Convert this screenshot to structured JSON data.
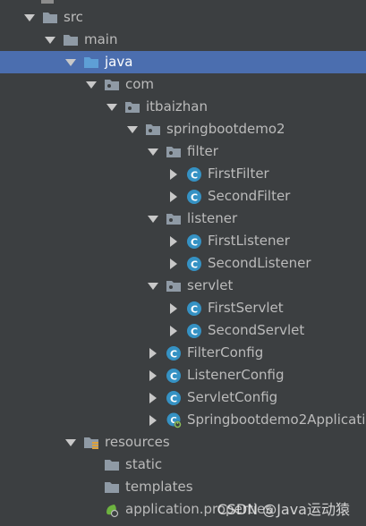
{
  "colors": {
    "background": "#3c3f41",
    "selection": "#4b6eaf",
    "text": "#bbbbbb",
    "folder": "#8f9aa5",
    "java_folder": "#5e9fd6",
    "class_icon": "#3592c4"
  },
  "tree": [
    {
      "label": "src",
      "depth": 0,
      "arrow": "expanded",
      "icon": "folder-icon"
    },
    {
      "label": "main",
      "depth": 1,
      "arrow": "expanded",
      "icon": "folder-icon"
    },
    {
      "label": "java",
      "depth": 2,
      "arrow": "expanded",
      "icon": "source-folder-icon",
      "selected": true
    },
    {
      "label": "com",
      "depth": 3,
      "arrow": "expanded",
      "icon": "package-icon"
    },
    {
      "label": "itbaizhan",
      "depth": 4,
      "arrow": "expanded",
      "icon": "package-icon"
    },
    {
      "label": "springbootdemo2",
      "depth": 5,
      "arrow": "expanded",
      "icon": "package-icon"
    },
    {
      "label": "filter",
      "depth": 6,
      "arrow": "expanded",
      "icon": "package-icon"
    },
    {
      "label": "FirstFilter",
      "depth": 7,
      "arrow": "collapsed",
      "icon": "class-icon"
    },
    {
      "label": "SecondFilter",
      "depth": 7,
      "arrow": "collapsed",
      "icon": "class-icon"
    },
    {
      "label": "listener",
      "depth": 6,
      "arrow": "expanded",
      "icon": "package-icon"
    },
    {
      "label": "FirstListener",
      "depth": 7,
      "arrow": "collapsed",
      "icon": "class-icon"
    },
    {
      "label": "SecondListener",
      "depth": 7,
      "arrow": "collapsed",
      "icon": "class-icon"
    },
    {
      "label": "servlet",
      "depth": 6,
      "arrow": "expanded",
      "icon": "package-icon"
    },
    {
      "label": "FirstServlet",
      "depth": 7,
      "arrow": "collapsed",
      "icon": "class-icon"
    },
    {
      "label": "SecondServlet",
      "depth": 7,
      "arrow": "collapsed",
      "icon": "class-icon"
    },
    {
      "label": "FilterConfig",
      "depth": 6,
      "arrow": "collapsed",
      "icon": "class-icon"
    },
    {
      "label": "ListenerConfig",
      "depth": 6,
      "arrow": "collapsed",
      "icon": "class-icon"
    },
    {
      "label": "ServletConfig",
      "depth": 6,
      "arrow": "collapsed",
      "icon": "class-icon"
    },
    {
      "label": "Springbootdemo2Applicati",
      "depth": 6,
      "arrow": "collapsed",
      "icon": "spring-boot-class-icon"
    },
    {
      "label": "resources",
      "depth": 2,
      "arrow": "expanded",
      "icon": "resources-folder-icon"
    },
    {
      "label": "static",
      "depth": 3,
      "arrow": "none",
      "icon": "folder-icon"
    },
    {
      "label": "templates",
      "depth": 3,
      "arrow": "none",
      "icon": "folder-icon"
    },
    {
      "label": "application.properties",
      "depth": 3,
      "arrow": "none",
      "icon": "properties-file-icon"
    }
  ],
  "watermark": "CSDN @Java运动猿"
}
